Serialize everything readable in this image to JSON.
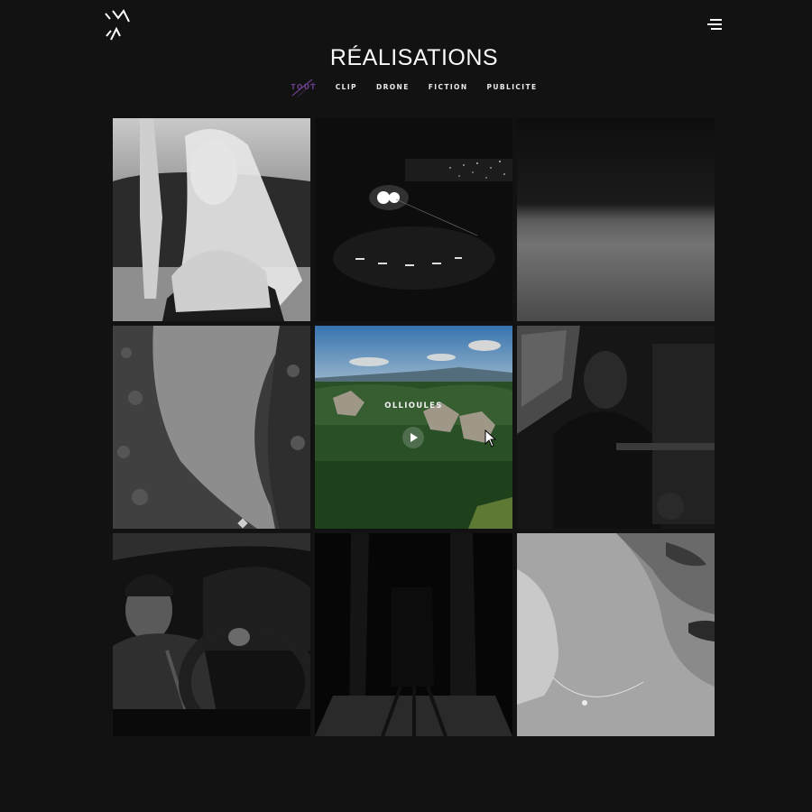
{
  "page": {
    "title": "RÉALISATIONS"
  },
  "filters": [
    {
      "label": "TOUT",
      "active": true
    },
    {
      "label": "CLIP",
      "active": false
    },
    {
      "label": "DRONE",
      "active": false
    },
    {
      "label": "FICTION",
      "active": false
    },
    {
      "label": "PUBLICITE",
      "active": false
    }
  ],
  "colors": {
    "background": "#121212",
    "active_filter": "#6a3f8a"
  },
  "icons": {
    "logo": "brand-logo",
    "menu": "hamburger-menu-icon",
    "play": "play-icon",
    "cursor": "mouse-pointer"
  },
  "projects": [
    {
      "id": 1,
      "subject": "portrait-woman-arm-raised"
    },
    {
      "id": 2,
      "subject": "night-stage-lights"
    },
    {
      "id": 3,
      "subject": "foggy-horizon"
    },
    {
      "id": 4,
      "subject": "aerial-lake-coast"
    },
    {
      "id": 5,
      "subject": "aerial-forest-rocks",
      "caption": "OLLIOULES",
      "hovered": true
    },
    {
      "id": 6,
      "subject": "hooded-person-interior"
    },
    {
      "id": 7,
      "subject": "man-driving-car"
    },
    {
      "id": 8,
      "subject": "dark-corridor-figure"
    },
    {
      "id": 9,
      "subject": "closeup-neck-necklace"
    }
  ]
}
